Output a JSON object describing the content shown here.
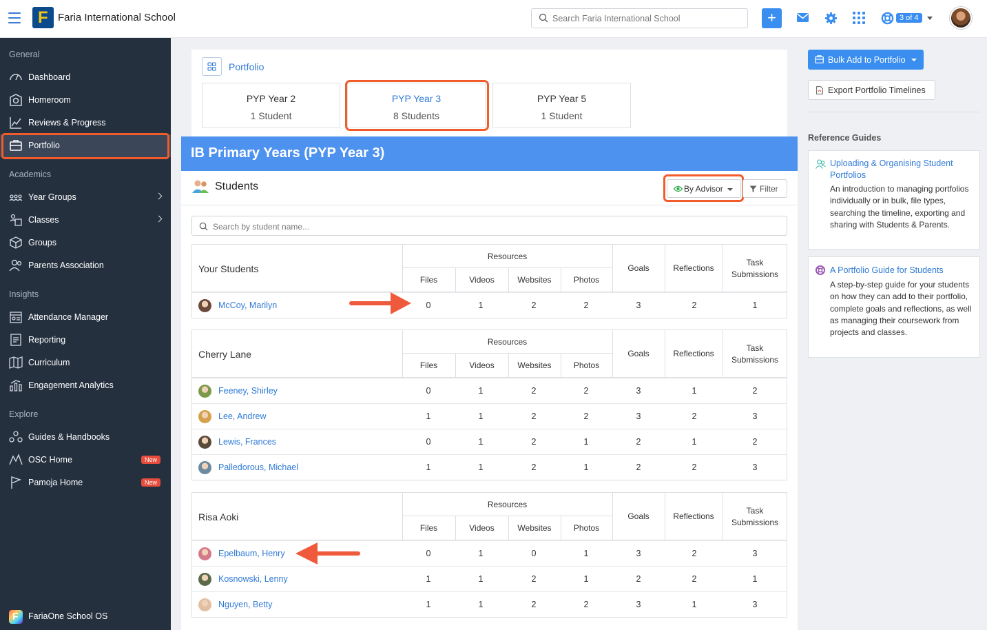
{
  "header": {
    "school_name": "Faria International School",
    "search_placeholder": "Search Faria International School",
    "add_label": "+",
    "count_badge": "3 of 4"
  },
  "sidebar": {
    "sections": [
      {
        "title": "General",
        "items": [
          {
            "label": "Dashboard",
            "icon": "dashboard-icon"
          },
          {
            "label": "Homeroom",
            "icon": "homeroom-icon"
          },
          {
            "label": "Reviews & Progress",
            "icon": "chart-icon"
          },
          {
            "label": "Portfolio",
            "icon": "portfolio-icon",
            "active": true
          }
        ]
      },
      {
        "title": "Academics",
        "items": [
          {
            "label": "Year Groups",
            "icon": "year-groups-icon",
            "chevron": true
          },
          {
            "label": "Classes",
            "icon": "classes-icon",
            "chevron": true
          },
          {
            "label": "Groups",
            "icon": "groups-icon"
          },
          {
            "label": "Parents Association",
            "icon": "parents-icon"
          }
        ]
      },
      {
        "title": "Insights",
        "items": [
          {
            "label": "Attendance Manager",
            "icon": "attendance-icon"
          },
          {
            "label": "Reporting",
            "icon": "reporting-icon"
          },
          {
            "label": "Curriculum",
            "icon": "curriculum-icon"
          },
          {
            "label": "Engagement Analytics",
            "icon": "analytics-icon"
          }
        ]
      },
      {
        "title": "Explore",
        "items": [
          {
            "label": "Guides & Handbooks",
            "icon": "guides-icon"
          },
          {
            "label": "OSC Home",
            "icon": "osc-icon",
            "badge": "New"
          },
          {
            "label": "Pamoja Home",
            "icon": "pamoja-icon",
            "badge": "New"
          }
        ]
      }
    ],
    "footer": "FariaOne School OS"
  },
  "portfolio": {
    "title": "Portfolio",
    "years": [
      {
        "name": "PYP Year 2",
        "students": "1 Student"
      },
      {
        "name": "PYP Year 3",
        "students": "8 Students",
        "selected": true
      },
      {
        "name": "PYP Year 5",
        "students": "1 Student"
      }
    ],
    "banner": "IB Primary Years (PYP Year 3)",
    "students_label": "Students",
    "by_advisor": "By Advisor",
    "filter": "Filter",
    "search_placeholder": "Search by student name..."
  },
  "columns": {
    "resources": "Resources",
    "files": "Files",
    "videos": "Videos",
    "websites": "Websites",
    "photos": "Photos",
    "goals": "Goals",
    "reflections": "Reflections",
    "task_submissions_1": "Task",
    "task_submissions_2": "Submissions"
  },
  "groups": [
    {
      "name": "Your Students",
      "rows": [
        {
          "name": "McCoy, Marilyn",
          "vals": [
            "0",
            "1",
            "2",
            "2",
            "3",
            "2",
            "1"
          ],
          "avatar": "#6b4a3a"
        }
      ]
    },
    {
      "name": "Cherry Lane",
      "rows": [
        {
          "name": "Feeney, Shirley",
          "vals": [
            "0",
            "1",
            "2",
            "2",
            "3",
            "1",
            "2"
          ],
          "avatar": "#7a9a4a"
        },
        {
          "name": "Lee, Andrew",
          "vals": [
            "1",
            "1",
            "2",
            "2",
            "3",
            "2",
            "3"
          ],
          "avatar": "#d4a24a"
        },
        {
          "name": "Lewis, Frances",
          "vals": [
            "0",
            "1",
            "2",
            "1",
            "2",
            "1",
            "2"
          ],
          "avatar": "#5a4a3a"
        },
        {
          "name": "Palledorous, Michael",
          "vals": [
            "1",
            "1",
            "2",
            "1",
            "2",
            "2",
            "3"
          ],
          "avatar": "#6a8aa0"
        }
      ]
    },
    {
      "name": "Risa Aoki",
      "rows": [
        {
          "name": "Epelbaum, Henry",
          "vals": [
            "0",
            "1",
            "0",
            "1",
            "3",
            "2",
            "3"
          ],
          "avatar": "#d47a8a"
        },
        {
          "name": "Kosnowski, Lenny",
          "vals": [
            "1",
            "1",
            "2",
            "1",
            "2",
            "2",
            "1"
          ],
          "avatar": "#5a6a4a"
        },
        {
          "name": "Nguyen, Betty",
          "vals": [
            "1",
            "1",
            "2",
            "2",
            "3",
            "1",
            "3"
          ],
          "avatar": "#e0c0a0"
        }
      ]
    }
  ],
  "right": {
    "bulk_add": "Bulk Add to Portfolio",
    "export": "Export Portfolio Timelines",
    "ref_title": "Reference Guides",
    "guides": [
      {
        "title": "Uploading & Organising Student Portfolios",
        "desc": "An introduction to managing portfolios individually or in bulk, file types, searching the timeline, exporting and sharing with Students & Parents."
      },
      {
        "title": "A Portfolio Guide for Students",
        "desc": "A step-by-step guide for your students on how they can add to their portfolio, complete goals and reflections, as well as managing their coursework from projects and classes."
      }
    ]
  },
  "colors": {
    "accent": "#3a8ef0",
    "banner": "#4e92ef",
    "highlight": "#f25c2b",
    "sidebar": "#25303f"
  }
}
